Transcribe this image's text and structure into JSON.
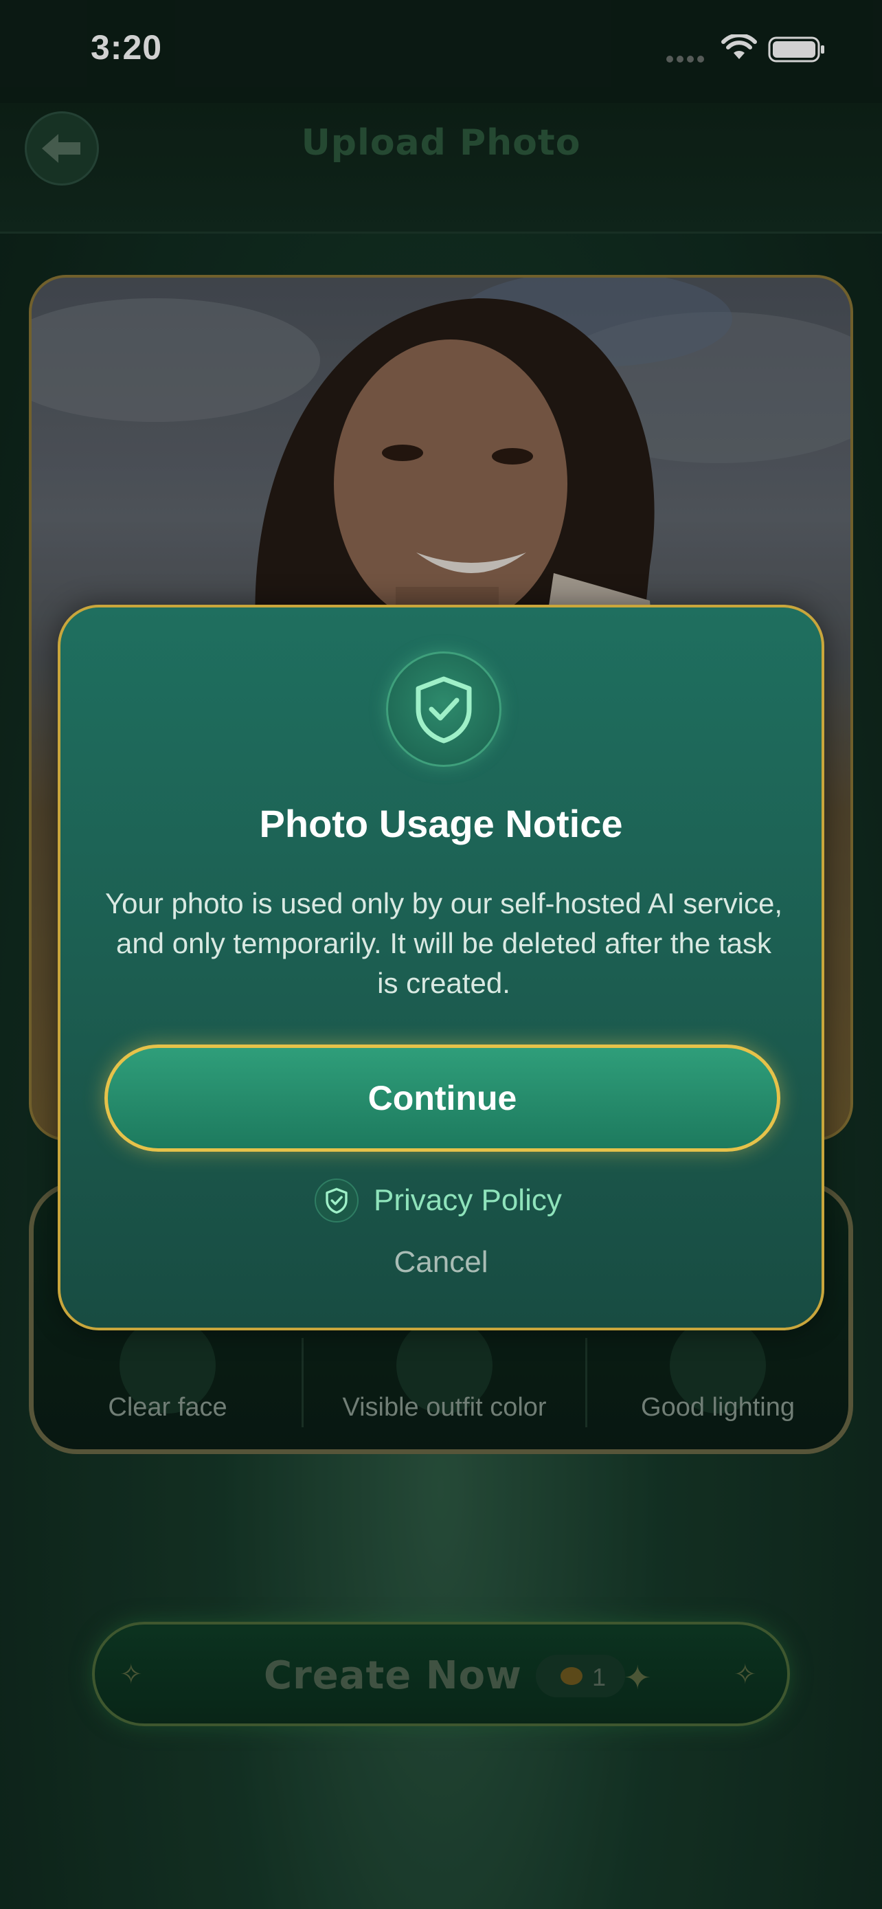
{
  "status_bar": {
    "time": "3:20",
    "wifi_icon": "wifi-icon",
    "battery_icon": "battery-icon"
  },
  "header": {
    "title": "Upload Photo",
    "back_icon": "arrow-left-icon"
  },
  "photo": {
    "description_icon": "portrait-photo"
  },
  "tips": {
    "items": [
      {
        "label": "Clear face",
        "icon": "face-icon"
      },
      {
        "label": "Visible outfit color",
        "icon": "outfit-icon"
      },
      {
        "label": "Good lighting",
        "icon": "sun-icon"
      }
    ]
  },
  "create": {
    "label": "Create Now",
    "credits": "1",
    "coin_icon": "coin-icon"
  },
  "modal": {
    "badge_icon": "shield-check-icon",
    "title": "Photo Usage Notice",
    "body": "Your photo is used only by our self-hosted AI service, and only temporarily. It will be deleted after the task is created.",
    "continue_label": "Continue",
    "privacy_label": "Privacy Policy",
    "privacy_icon": "shield-check-icon",
    "cancel_label": "Cancel"
  },
  "colors": {
    "accent_gold": "#c9a63c",
    "modal_green": "#1f6f5f",
    "link_green": "#8fe3bb"
  }
}
